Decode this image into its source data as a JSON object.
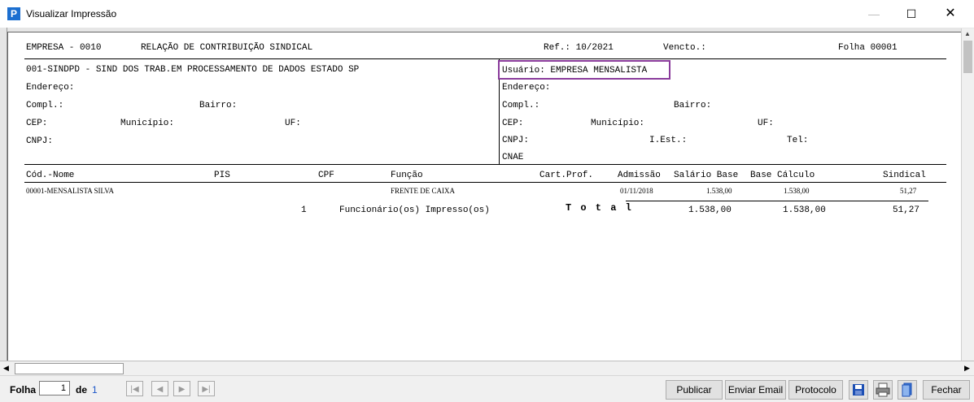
{
  "window": {
    "title": "Visualizar Impressão",
    "icon_letter": "P",
    "min": "—",
    "max": "☐",
    "close": "✕"
  },
  "report": {
    "header": {
      "empresa": "EMPRESA - 0010",
      "titulo": "RELAÇÃO DE CONTRIBUIÇÃO SINDICAL",
      "ref": "Ref.: 10/2021",
      "vencto": "Vencto.:",
      "folha": "Folha 00001"
    },
    "sindicato": {
      "nome": "001-SINDPD - SIND DOS TRAB.EM PROCESSAMENTO DE DADOS ESTADO SP",
      "endereco": "Endereço:",
      "compl": "Compl.:",
      "bairro": "Bairro:",
      "cep": "CEP:",
      "municipio": "Município:",
      "uf": "UF:",
      "cnpj": "CNPJ:"
    },
    "usuario": {
      "nome": "Usuário: EMPRESA MENSALISTA",
      "endereco": "Endereço:",
      "compl": "Compl.:",
      "bairro": "Bairro:",
      "cep": "CEP:",
      "municipio": "Município:",
      "uf": "UF:",
      "cnpj": "CNPJ:",
      "iest": "I.Est.:",
      "tel": "Tel:",
      "cnae": "CNAE"
    },
    "columns": {
      "cod_nome": "Cód.-Nome",
      "pis": "PIS",
      "cpf": "CPF",
      "funcao": "Função",
      "cart_prof": "Cart.Prof.",
      "admissao": "Admissão",
      "salario_base": "Salário Base",
      "base_calculo": "Base Cálculo",
      "sindical": "Sindical"
    },
    "rows": [
      {
        "cod_nome": "00001-MENSALISTA SILVA",
        "funcao": "FRENTE DE CAIXA",
        "admissao": "01/11/2018",
        "salario_base": "1.538,00",
        "base_calculo": "1.538,00",
        "sindical": "51,27"
      }
    ],
    "totals": {
      "count": "1",
      "label": "Funcionário(os) Impresso(os)",
      "total_word": "T o t a l",
      "salario_base": "1.538,00",
      "base_calculo": "1.538,00",
      "sindical": "51,27"
    }
  },
  "toolbar": {
    "folha_label": "Folha",
    "page_value": "1",
    "de_label": "de",
    "page_total": "1",
    "publicar": "Publicar",
    "enviar_email": "Enviar Email",
    "protocolo": "Protocolo",
    "fechar": "Fechar"
  }
}
